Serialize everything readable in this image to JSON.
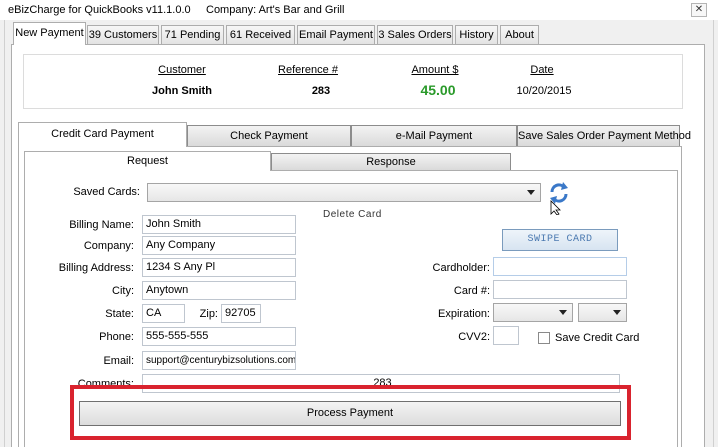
{
  "window": {
    "app_title": "eBizCharge for QuickBooks v11.1.0.0",
    "company": "Company: Art's Bar and Grill",
    "close_glyph": "✕"
  },
  "tabs": [
    {
      "label": "New Payment",
      "active": true
    },
    {
      "label": "39 Customers"
    },
    {
      "label": "71 Pending"
    },
    {
      "label": "61 Received"
    },
    {
      "label": "Email Payment"
    },
    {
      "label": "3 Sales Orders"
    },
    {
      "label": "History"
    },
    {
      "label": "About"
    }
  ],
  "summary": {
    "customer_label": "Customer",
    "customer_value": "John Smith",
    "reference_label": "Reference #",
    "reference_value": "283",
    "amount_label": "Amount $",
    "amount_value": "45.00",
    "date_label": "Date",
    "date_value": "10/20/2015",
    "amount_color": "#2a9a2a"
  },
  "payment_tabs": [
    {
      "label": "Credit Card Payment",
      "active": true
    },
    {
      "label": "Check Payment"
    },
    {
      "label": "e-Mail Payment"
    },
    {
      "label": "Save Sales Order Payment Method"
    }
  ],
  "sub_tabs": [
    {
      "label": "Request",
      "active": true
    },
    {
      "label": "Response"
    }
  ],
  "form": {
    "saved_cards_label": "Saved Cards:",
    "saved_cards_value": "",
    "refresh_icon": "refresh-icon",
    "delete_card_label": "Delete Card",
    "billing_name_label": "Billing Name:",
    "billing_name_value": "John Smith",
    "company_label": "Company:",
    "company_value": "Any Company",
    "billing_address_label": "Billing Address:",
    "billing_address_value": "1234 S Any Pl",
    "city_label": "City:",
    "city_value": "Anytown",
    "state_label": "State:",
    "state_value": "CA",
    "zip_label": "Zip:",
    "zip_value": "92705",
    "phone_label": "Phone:",
    "phone_value": "555-555-555",
    "email_label": "Email:",
    "email_value": "support@centurybizsolutions.com",
    "comments_label": "Comments:",
    "comments_value": "283",
    "swipe_label": "SWIPE CARD",
    "cardholder_label": "Cardholder:",
    "cardholder_value": "",
    "card_number_label": "Card #:",
    "card_number_value": "",
    "expiration_label": "Expiration:",
    "exp_month_value": "",
    "exp_year_value": "",
    "cvv2_label": "CVV2:",
    "cvv2_value": "",
    "save_card_label": "Save Credit Card",
    "save_card_checked": false
  },
  "actions": {
    "process_label": "Process Payment",
    "highlight_color": "#d9232e"
  }
}
